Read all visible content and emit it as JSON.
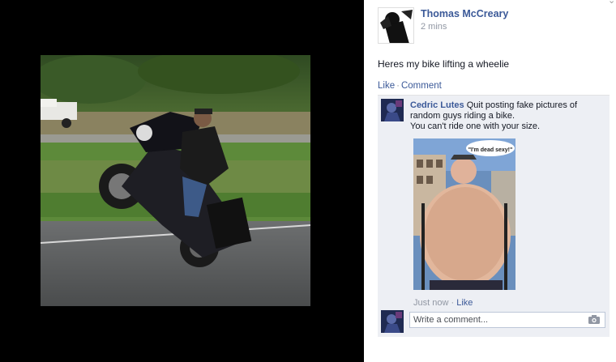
{
  "post": {
    "author": "Thomas McCreary",
    "time": "2 mins",
    "text": "Heres my bike lifting a wheelie",
    "like_label": "Like",
    "separator": "·",
    "comment_label": "Comment"
  },
  "comment": {
    "author": "Cedric Lutes",
    "text_line1": "Quit posting fake pictures of random guys riding a bike.",
    "text_line2": "You can't ride one with your size.",
    "image_caption": "\"I'm dead sexy!\"",
    "time": "Just now",
    "separator": "·",
    "like_label": "Like"
  },
  "reply": {
    "placeholder": "Write a comment..."
  },
  "icons": {
    "chevron": "chevron-down-icon",
    "camera": "camera-icon"
  },
  "colors": {
    "link": "#3b5998",
    "muted": "#9197a3",
    "comment_bg": "#edeff4"
  }
}
